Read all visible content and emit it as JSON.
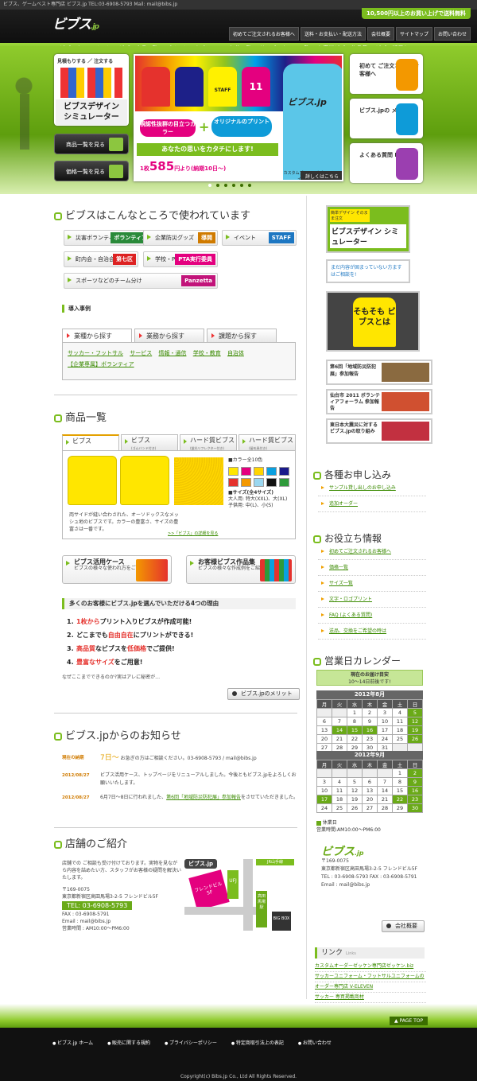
{
  "topbar": {
    "text": "ビブス、ゲームベスト専門店 ビブス.jp  TEL:03-6908-5793  Mail: mail@bibs.jp"
  },
  "header": {
    "logo": "ビブス",
    "logo_suffix": ".jp",
    "promo": "10,500円以上のお買い上げで送料無料",
    "nav": [
      "初めてご注文されるお客様へ",
      "送料・お支払い・配送方法",
      "会社概要",
      "サイトマップ",
      "お問い合わせ"
    ]
  },
  "gnav": [
    "ビブス.jpのメリット",
    "ビブス商品一覧",
    "プリント・オプション",
    "価格一覧",
    "サイズ・カラー一覧",
    "お客様ビブス作品集",
    "ビブス活用ケース",
    "FAQ"
  ],
  "hero": {
    "sim_top": "見積もりする ／ 注文する",
    "sim_title_1": "ビブスデザイン",
    "sim_title_2": "シミュレーター",
    "btn_products": "商品一覧を見る",
    "btn_prices": "価格一覧を見る",
    "bib_staff": "STAFF",
    "bib_11": "11",
    "pill_1": "視認性抜群の目立つカラー",
    "pill_2": "オリジナルのプリント",
    "slogan": "あなたの思いをカタチにします!",
    "price_pre": "1枚",
    "price": "585",
    "price_post": "円より(納期10日〜)",
    "person_label": "ビブス.jp",
    "caption": "カスタムプリントビブスのリーディングカンパニー",
    "detail": "詳しくはこちら",
    "right": [
      {
        "text": "初めて ご注文される お客様へ",
        "color": "#f39800"
      },
      {
        "text": "ビブス.jpの メリット",
        "color": "#0e9bd8"
      },
      {
        "text": "よくある質問 FAQ",
        "color": "#9b3fb0"
      }
    ]
  },
  "uses": {
    "title": "ビブスはこんなところで使われています",
    "chips": [
      {
        "label": "災害ボランティア",
        "tag": "ボランティア",
        "tag_color": "#2a8a3a"
      },
      {
        "label": "企業防災グッズ",
        "tag": "導開",
        "tag_color": "#d07b00"
      },
      {
        "label": "イベント",
        "tag": "STAFF",
        "tag_color": "#1d77c2"
      },
      {
        "label": "町内会・自治会",
        "tag": "第七区",
        "tag_color": "#d22"
      },
      {
        "label": "学校・PTA",
        "tag": "PTA実行委員",
        "tag_color": "#e4007f"
      },
      {
        "label": "スポーツなどのチーム分け",
        "tag": "Panzetta",
        "tag_color": "#c2147a"
      }
    ],
    "cases_h": "導入事例",
    "tabs": [
      "業種から探す",
      "業務から探す",
      "課題から探す"
    ],
    "industries": [
      "サッカー・フットサル",
      "サービス",
      "情報・通信",
      "学校・教育",
      "自治体"
    ],
    "industries_2": "【企業専属】ボランティア"
  },
  "products": {
    "title": "商品一覧",
    "tabs": [
      {
        "label": "ビブス",
        "sub": ""
      },
      {
        "label": "ビブス",
        "sub": "(ゴムバンド付き)"
      },
      {
        "label": "ハード質ビブス",
        "sub": "(蛍光リフレクター付き)"
      },
      {
        "label": "ハード質ビブス",
        "sub": "(留め具付き)"
      }
    ],
    "desc": "両サイドが縫い合わされた、オーソドックスなメッシュ地のビブスです。カラーの豊富さ、サイズの豊富さは一番です。",
    "detail_link": ">>「ビブス」の詳細を見る",
    "colors_h": "■カラー全10色",
    "colors": [
      "#ffe600",
      "#e4007f",
      "#ffd400",
      "#0aa0e0",
      "#1a1a8a",
      "#e5322d",
      "#f39800",
      "#9ad7f0",
      "#111111",
      "#2e9a3a"
    ],
    "sizes_h": "■サイズ(全4サイズ)",
    "sizes_1": "大人用: 特大(XXL)、大(XL)",
    "sizes_2": "子供用: 中(L)、小(S)",
    "case_1_title": "ビブス活用ケース",
    "case_1_text": "ビブスの様々な使われ方をご紹介ください!",
    "case_2_title": "お客様ビブス作品集",
    "case_2_text": "ビブスの様々な作成例をご紹介ください!"
  },
  "reasons": {
    "heading": "多くのお客様にビブス.jpを選んでいただける4つの理由",
    "items": [
      {
        "n": "1.",
        "hl": "1枚から",
        "rest": "プリント入りビブスが作成可能!"
      },
      {
        "n": "2.",
        "pre": "どこまでも",
        "hl": "自由自在",
        "rest": "にプリントができる!"
      },
      {
        "n": "3.",
        "hl": "高品質",
        "mid": "なビブスを",
        "hl2": "低価格",
        "rest": "でご提供!"
      },
      {
        "n": "4.",
        "hl": "豊富なサイズ",
        "rest": "をご用意!"
      }
    ],
    "note": "なぜここまでできるのか?実はアレに秘密が…",
    "merit_btn": "ビブス.jpのメリット"
  },
  "news": {
    "title": "ビブス.jpからのお知らせ",
    "items": [
      {
        "date": "現在の納期",
        "hl": "7日〜",
        "text": " お急ぎの方はご相談ください。03-6908-5793 / mail@bibs.jp"
      },
      {
        "date": "2012/08/27",
        "text": "ビブス活用ケース、トップページをリニューアルしました。今後ともビブス.jpをよろしくお願いいたします。"
      },
      {
        "date": "2012/08/27",
        "text_pre": "6月7日〜8日に行われました、",
        "link": "第6回「地域防災防犯展」参加報告",
        "text_post": "をさせていただきました。"
      }
    ]
  },
  "shop": {
    "title": "店舗のご紹介",
    "intro": "店舗での ご相談も受け付けております。実物を見ながら内容を詰めたい方、スタッフがお客様の疑問を解決いたします。",
    "postal": "〒169-0075",
    "address": "東京都新宿区高田馬場3-2-5 フレンドビル5F",
    "tel": "TEL: 03-6908-5793",
    "fax": "FAX : 03-6908-5791",
    "email": "Email : mail@bibs.jp",
    "hours": "営業時間 : AM10:00〜PM6:00",
    "map_shop": "ビブス.jp",
    "map_building": "フレンドビル 5F",
    "map_ufj": "UFJ",
    "map_rail": "JR山手線",
    "map_station": "高田馬場駅",
    "map_bigbox": "BIG BOX"
  },
  "sidebar": {
    "sim_small": "簡単デザイン そのまま注文",
    "sim_title": "ビブスデザイン シミュレーター",
    "consult": "まだ内容が固まっていない方ますはご相談を!",
    "whatis": "そもそも ビブスとは",
    "reports": [
      {
        "text": "第6回「地域防災防犯展」参加報告",
        "color": "#8a6a40"
      },
      {
        "text": "仙台市 2011 ボランティアフォーラム 参加報告",
        "color": "#d05030"
      },
      {
        "text": "東日本大震災に対するビブス.jpの取り組み",
        "color": "#c23040"
      }
    ],
    "apply_h": "各種お申し込み",
    "apply": [
      "サンプル貸し出しのお申し込み",
      "追加オーダー"
    ],
    "useful_h": "お役立ち情報",
    "useful": [
      "初めてご注文されるお客様へ",
      "価格一覧",
      "サイズ一覧",
      "文字・ロゴプリント",
      "FAQ (よくある質問)",
      "送品、交換をご希望の時は"
    ],
    "calendar_h": "営業日カレンダー",
    "cal_notice_1": "現在のお届け目安",
    "cal_notice_2": "10〜14日前後です!",
    "weekdays": [
      "月",
      "火",
      "水",
      "木",
      "金",
      "土",
      "日"
    ],
    "months": [
      {
        "title": "2012年8月",
        "weeks": [
          [
            "",
            "",
            "1",
            "2",
            "3",
            "4",
            "5"
          ],
          [
            "6",
            "7",
            "8",
            "9",
            "10",
            "11",
            "12"
          ],
          [
            "13",
            "14",
            "15",
            "16",
            "17",
            "18",
            "19"
          ],
          [
            "20",
            "21",
            "22",
            "23",
            "24",
            "25",
            "26"
          ],
          [
            "27",
            "28",
            "29",
            "30",
            "31",
            "",
            ""
          ]
        ],
        "green": [
          "5",
          "12",
          "14",
          "15",
          "16",
          "19",
          "26"
        ]
      },
      {
        "title": "2012年9月",
        "weeks": [
          [
            "",
            "",
            "",
            "",
            "",
            "1",
            "2"
          ],
          [
            "3",
            "4",
            "5",
            "6",
            "7",
            "8",
            "9"
          ],
          [
            "10",
            "11",
            "12",
            "13",
            "14",
            "15",
            "16"
          ],
          [
            "17",
            "18",
            "19",
            "20",
            "21",
            "22",
            "23"
          ],
          [
            "24",
            "25",
            "26",
            "27",
            "28",
            "29",
            "30"
          ]
        ],
        "green": [
          "2",
          "9",
          "16",
          "17",
          "22",
          "23",
          "30"
        ]
      }
    ],
    "cal_legend": "休業日",
    "cal_hours": "営業時間:AM10:00〜PM6:00",
    "co_logo": "ビブス",
    "co_logo_suffix": ".jp",
    "co_postal": "〒169-0075",
    "co_address": "東京都新宿区高田馬場3-2-5 フレンドビル5F",
    "co_tel": "TEL : 03-6908-5793  FAX : 03-6908-5791",
    "co_email": "Email : mail@bibs.jp",
    "co_btn": "会社概要",
    "links_h": "リンク",
    "links_h_sub": "Links",
    "links": [
      "カスタムオーダーゼッケン専門店ゼッケン.biz",
      "サッカーユニフォーム・フットサルユニフォームの",
      "オーダー専門店 V-ELEVEN",
      "サッカー 専買掲載商材"
    ]
  },
  "pagetop": "PAGE TOP",
  "footer": {
    "nav": [
      "ビブス.jp ホーム",
      "販売に関する規約",
      "プライバシーポリシー",
      "特定商取引法上の表記",
      "お問い合わせ"
    ],
    "copy": "Copyright(c) Bibs.jp Co., Ltd All Rights Reserved."
  }
}
